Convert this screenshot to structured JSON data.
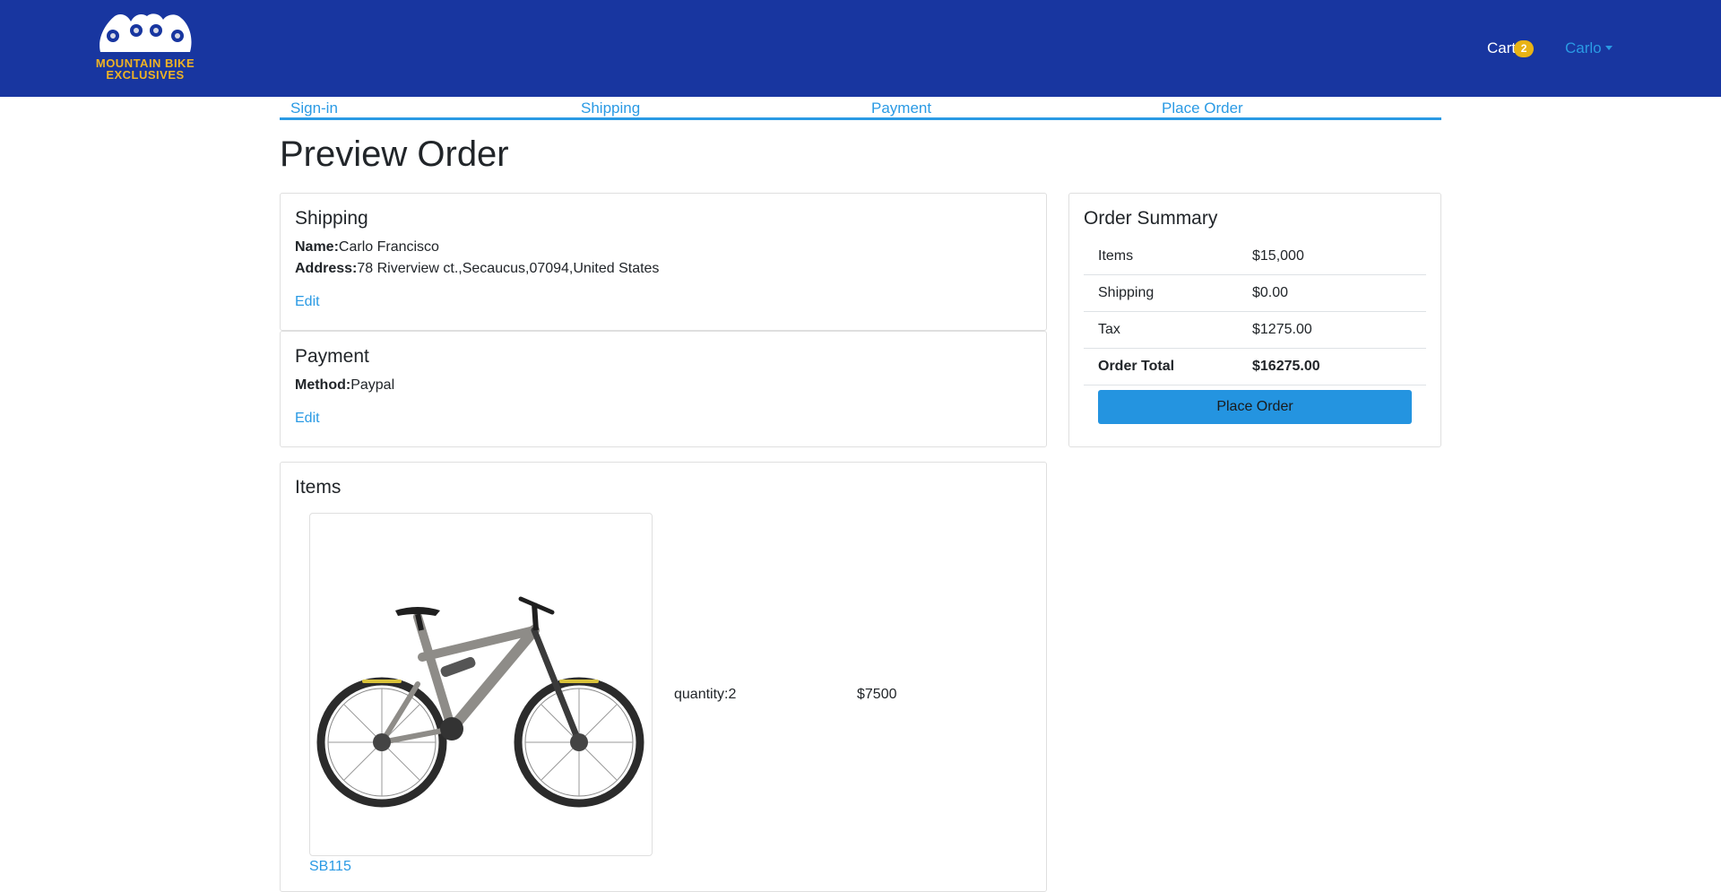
{
  "header": {
    "logo_line1": "MOUNTAIN BIKE",
    "logo_line2": "EXCLUSIVES",
    "cart_label": "Cart",
    "cart_count": "2",
    "user_name": "Carlo"
  },
  "steps": [
    "Sign-in",
    "Shipping",
    "Payment",
    "Place Order"
  ],
  "page_title": "Preview Order",
  "shipping": {
    "title": "Shipping",
    "name_label": "Name:",
    "name_value": "Carlo Francisco",
    "address_label": "Address:",
    "address_value": "78 Riverview ct.,Secaucus,07094,United States",
    "edit_label": "Edit"
  },
  "payment": {
    "title": "Payment",
    "method_label": "Method:",
    "method_value": "Paypal",
    "edit_label": "Edit"
  },
  "items_section": {
    "title": "Items",
    "items": [
      {
        "name": "SB115",
        "quantity_text": "quantity:2",
        "price": "$7500"
      }
    ]
  },
  "summary": {
    "title": "Order Summary",
    "rows": [
      {
        "label": "Items",
        "value": "$15,000"
      },
      {
        "label": "Shipping",
        "value": "$0.00"
      },
      {
        "label": "Tax",
        "value": "$1275.00"
      },
      {
        "label": "Order Total",
        "value": "$16275.00"
      }
    ],
    "button_label": "Place Order"
  },
  "colors": {
    "navbar": "#1836a0",
    "accent": "#2a9ae4",
    "logo_gold": "#f0b323",
    "badge": "#e8b315",
    "button": "#2494e0"
  }
}
